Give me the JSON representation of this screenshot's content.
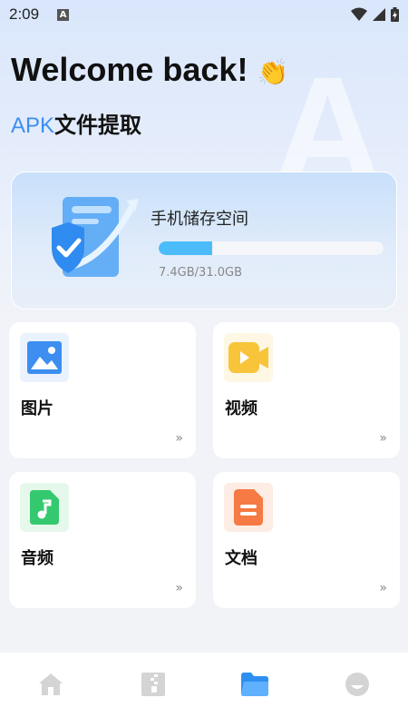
{
  "status_bar": {
    "time": "2:09",
    "notif_letter": "A"
  },
  "bg_letter": "A",
  "header": {
    "welcome": "Welcome back!",
    "wave_emoji": "👏",
    "subtitle_apk": "APK",
    "subtitle_rest": "文件提取"
  },
  "storage": {
    "title": "手机储存空间",
    "used_text": "7.4GB/31.0GB",
    "used_fraction": 0.239
  },
  "categories": [
    {
      "label": "图片",
      "icon": "image-icon",
      "arrow": "»"
    },
    {
      "label": "视频",
      "icon": "video-icon",
      "arrow": "»"
    },
    {
      "label": "音频",
      "icon": "audio-icon",
      "arrow": "»"
    },
    {
      "label": "文档",
      "icon": "document-icon",
      "arrow": "»"
    }
  ],
  "bottom_nav": [
    {
      "name": "home",
      "icon": "home-icon"
    },
    {
      "name": "archive",
      "icon": "archive-icon"
    },
    {
      "name": "files",
      "icon": "folder-icon",
      "active": true
    },
    {
      "name": "profile",
      "icon": "profile-icon"
    }
  ],
  "colors": {
    "accent": "#3b8ff0",
    "storage_fill": "#4bbcf9",
    "nav_active": "#2e8ff2",
    "nav_inactive": "#d4d4d4",
    "image_icon": "#3d8ef0",
    "video_icon": "#f7c43a",
    "audio_icon": "#35c96f",
    "document_icon": "#f57a43"
  }
}
